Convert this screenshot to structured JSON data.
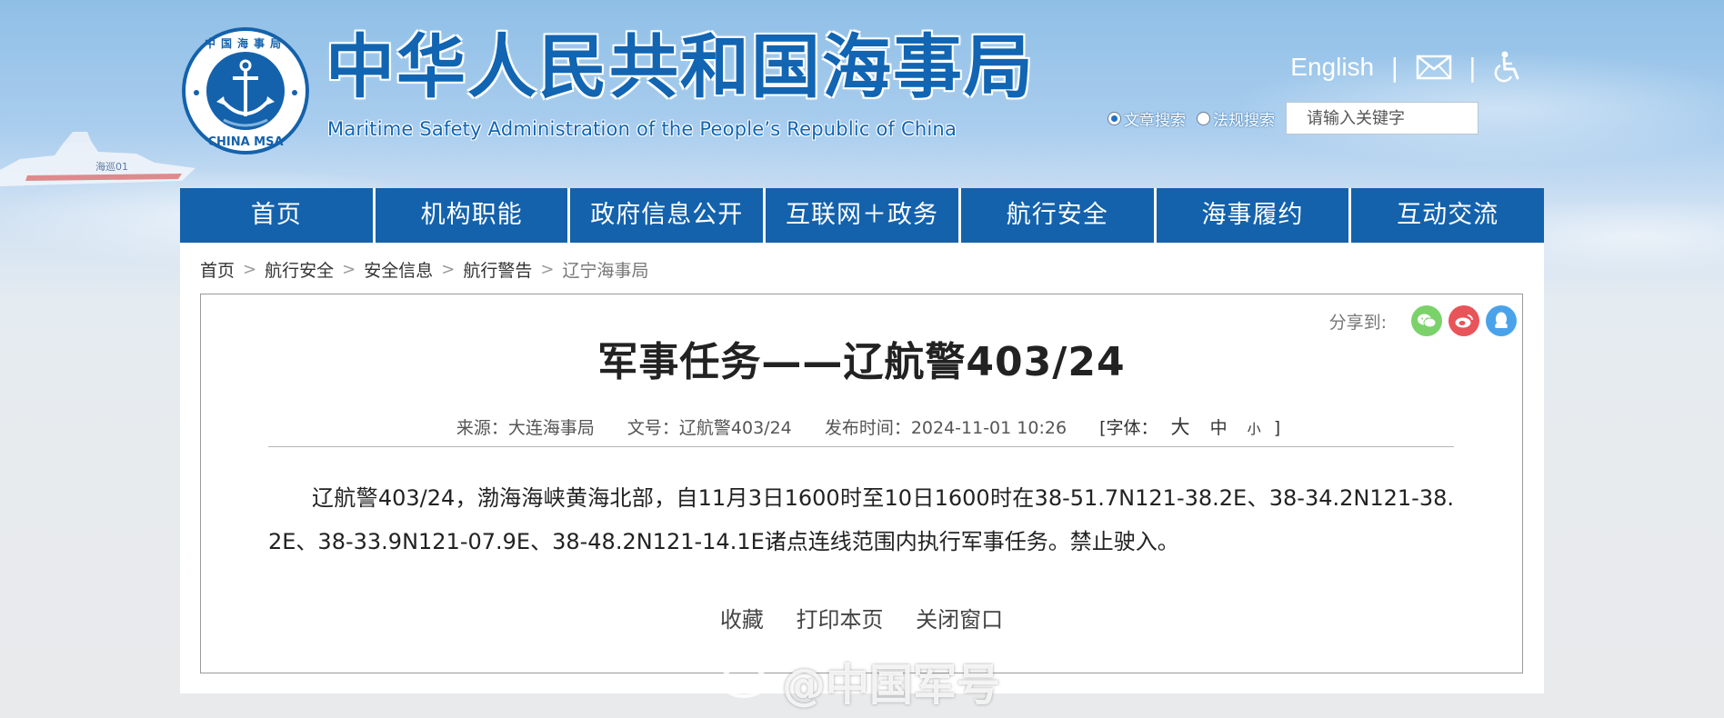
{
  "header": {
    "title": "中华人民共和国海事局",
    "subtitle": "Maritime Safety Administration of the People’s Republic of China",
    "seal_top_text": "中国海事局",
    "seal_bottom_text": "CHINA MSA",
    "ship_label": "海巡01"
  },
  "top_links": {
    "language": "English",
    "mail_icon": "mail-icon",
    "accessibility_icon": "wheelchair-icon"
  },
  "search": {
    "option_article": "文章搜索",
    "option_regulation": "法规搜索",
    "selected": "文章搜索",
    "placeholder": "请输入关键字"
  },
  "nav": {
    "items": [
      {
        "label": "首页"
      },
      {
        "label": "机构职能"
      },
      {
        "label": "政府信息公开"
      },
      {
        "label": "互联网＋政务"
      },
      {
        "label": "航行安全"
      },
      {
        "label": "海事履约"
      },
      {
        "label": "互动交流"
      }
    ]
  },
  "breadcrumb": {
    "items": [
      "首页",
      "航行安全",
      "安全信息",
      "航行警告",
      "辽宁海事局"
    ],
    "separator": ">"
  },
  "share": {
    "label": "分享到:",
    "targets": [
      "wechat-icon",
      "weibo-icon",
      "qq-icon"
    ],
    "colors": {
      "wechat": "#7bd26a",
      "weibo": "#e8545a",
      "qq": "#4aa3ea"
    }
  },
  "article": {
    "title": "军事任务——辽航警403/24",
    "source": "来源：大连海事局",
    "doc_no": "文号：辽航警403/24",
    "publish_time": "发布时间：2024-11-01 10:26",
    "font_label": "[字体：",
    "font_large": "大",
    "font_medium": "中",
    "font_small": "小",
    "font_close": "]",
    "body": "辽航警403/24，渤海海峡黄海北部，自11月3日1600时至10日1600时在38-51.7N121-38.2E、38-34.2N121-38.2E、38-33.9N121-07.9E、38-48.2N121-14.1E诸点连线范围内执行军事任务。禁止驶入。"
  },
  "actions": {
    "favorite": "收藏",
    "print": "打印本页",
    "close": "关闭窗口"
  },
  "watermark": {
    "text": "@中国军号"
  },
  "colors": {
    "nav_bg": "#1462ac",
    "title_blue": "#1165b2"
  }
}
